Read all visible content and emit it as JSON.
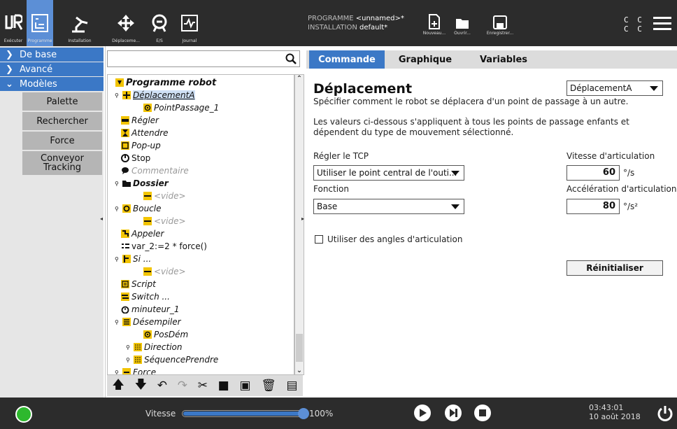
{
  "header": {
    "nav": [
      {
        "label": "Exécuter"
      },
      {
        "label": "Programme"
      },
      {
        "label": "Installation"
      },
      {
        "label": "Déplaceme..."
      },
      {
        "label": "E/S"
      },
      {
        "label": "Journal"
      }
    ],
    "program_label": "PROGRAMME",
    "program_value": "<unnamed>*",
    "installation_label": "INSTALLATION",
    "installation_value": "default*",
    "file_buttons": [
      {
        "label": "Nouveau..."
      },
      {
        "label": "Ouvrir..."
      },
      {
        "label": "Enregistrer..."
      }
    ],
    "cc": "C C\nC C"
  },
  "sidebar": {
    "sections": [
      {
        "label": "De base",
        "icon": "chevron-right-icon"
      },
      {
        "label": "Avancé",
        "icon": "chevron-right-icon"
      },
      {
        "label": "Modèles",
        "icon": "chevron-down-icon"
      }
    ],
    "templates": [
      "Palette",
      "Rechercher",
      "Force",
      "Conveyor Tracking"
    ]
  },
  "tree": {
    "search_value": "",
    "nodes": [
      {
        "label": "Programme robot",
        "style": "bd",
        "icon": "program-icon"
      },
      {
        "label": "DéplacementA",
        "style": "it",
        "icon": "move-icon",
        "selected": true,
        "expander": true
      },
      {
        "label": "PointPassage_1",
        "style": "it",
        "icon": "waypoint-icon"
      },
      {
        "label": "Régler",
        "style": "it",
        "icon": "set-icon"
      },
      {
        "label": "Attendre",
        "style": "it",
        "icon": "wait-icon"
      },
      {
        "label": "Pop-up",
        "style": "it",
        "icon": "popup-icon"
      },
      {
        "label": "Stop",
        "style": "",
        "icon": "stop-icon"
      },
      {
        "label": "Commentaire",
        "style": "gr",
        "icon": "comment-icon"
      },
      {
        "label": "Dossier",
        "style": "bd",
        "icon": "folder-icon",
        "expander": true
      },
      {
        "label": "<vide>",
        "style": "gr",
        "icon": "empty-icon"
      },
      {
        "label": "Boucle",
        "style": "it",
        "icon": "loop-icon",
        "expander": true
      },
      {
        "label": "<vide>",
        "style": "gr",
        "icon": "empty-icon"
      },
      {
        "label": "Appeler",
        "style": "it",
        "icon": "call-icon"
      },
      {
        "label": "var_2:=2 * force()",
        "style": "",
        "icon": "assignment-icon"
      },
      {
        "label": "Si ...",
        "style": "it",
        "icon": "if-icon",
        "expander": true
      },
      {
        "label": "<vide>",
        "style": "gr",
        "icon": "empty-icon"
      },
      {
        "label": "Script",
        "style": "it",
        "icon": "script-icon"
      },
      {
        "label": "Switch ...",
        "style": "it",
        "icon": "switch-icon"
      },
      {
        "label": "minuteur_1",
        "style": "it",
        "icon": "timer-icon"
      },
      {
        "label": "Désempiler",
        "style": "it",
        "icon": "destack-icon",
        "expander": true
      },
      {
        "label": "PosDém",
        "style": "it",
        "icon": "waypoint-icon"
      },
      {
        "label": "Direction",
        "style": "it",
        "icon": "direction-icon",
        "expander": true
      },
      {
        "label": "SéquencePrendre",
        "style": "it",
        "icon": "sequence-icon",
        "expander": true
      },
      {
        "label": "Force",
        "style": "it",
        "icon": "force-icon",
        "expander": true
      }
    ]
  },
  "tabs": [
    "Commande",
    "Graphique",
    "Variables"
  ],
  "command": {
    "title": "Déplacement",
    "move_type": "DéplacementA",
    "desc1": "Spécifier comment le robot se déplacera d'un point de passage à un autre.",
    "desc2": "Les valeurs ci-dessous s'appliquent à tous les points de passage enfants et dépendent du type de mouvement sélectionné.",
    "tcp_label": "Régler le TCP",
    "tcp_value": "Utiliser le point central de l'outi...",
    "function_label": "Fonction",
    "function_value": "Base",
    "joint_speed_label": "Vitesse d'articulation",
    "joint_speed_value": "60",
    "joint_speed_unit": "°/s",
    "joint_accel_label": "Accélération d'articulation",
    "joint_accel_value": "80",
    "joint_accel_unit": "°/s²",
    "joint_angles_label": "Utiliser des angles d'articulation",
    "reset_label": "Réinitialiser"
  },
  "footer": {
    "speed_label": "Vitesse",
    "speed_value": "100%",
    "speed_fraction": 1.0,
    "time": "03:43:01",
    "date": "10 août 2018"
  },
  "colors": {
    "accent": "#3b78c6",
    "dark": "#2c2c2c",
    "status_ok": "#2eb82e"
  }
}
